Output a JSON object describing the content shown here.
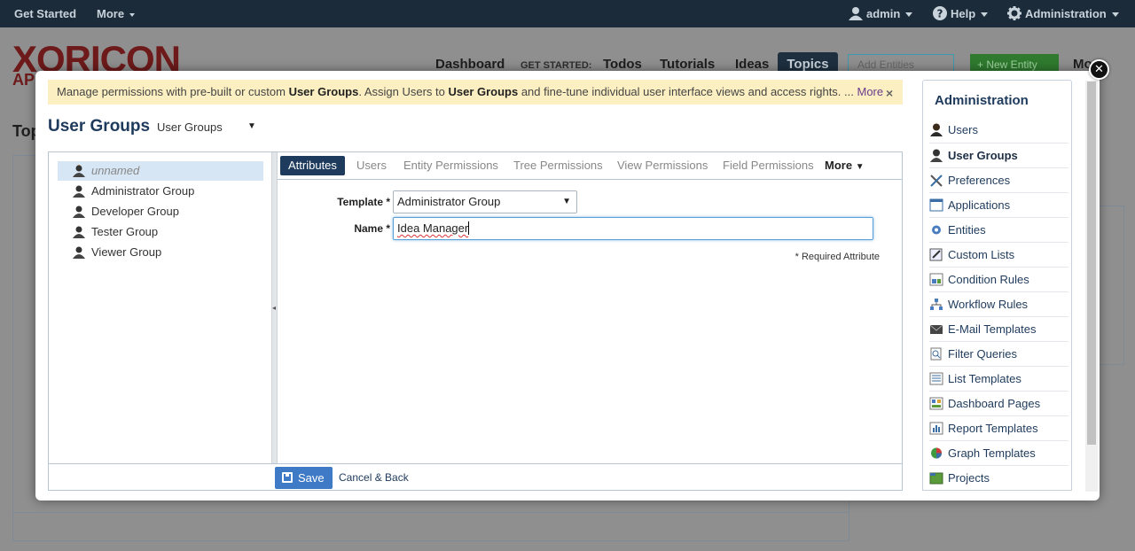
{
  "topbar": {
    "get_started": "Get Started",
    "more": "More",
    "user": "admin",
    "help": "Help",
    "administration": "Administration"
  },
  "background": {
    "logo": "XORICON",
    "logo_sub": "AP",
    "nav": {
      "dashboard": "Dashboard",
      "get_started_label": "GET STARTED:",
      "todos": "Todos",
      "tutorials": "Tutorials",
      "ideas": "Ideas",
      "topics": "Topics",
      "search_placeholder": "Add Entities",
      "new_entity": "New Entity",
      "more": "Mo"
    },
    "page_title": "Top"
  },
  "banner": {
    "text_1": "Manage permissions with pre-built or custom ",
    "bold_1": "User Groups",
    "text_2": ". Assign Users to ",
    "bold_2": "User Groups",
    "text_3": " and fine-tune individual user interface views and access rights. ... ",
    "more": "More",
    "close": "×"
  },
  "header": {
    "title": "User Groups",
    "selector_value": "User Groups"
  },
  "groups": [
    {
      "label": "unnamed"
    },
    {
      "label": "Administrator Group"
    },
    {
      "label": "Developer Group"
    },
    {
      "label": "Tester Group"
    },
    {
      "label": "Viewer Group"
    }
  ],
  "tabs": [
    {
      "label": "Attributes"
    },
    {
      "label": "Users"
    },
    {
      "label": "Entity Permissions"
    },
    {
      "label": "Tree Permissions"
    },
    {
      "label": "View Permissions"
    },
    {
      "label": "Field Permissions"
    },
    {
      "label": "More"
    }
  ],
  "form": {
    "template_label": "Template *",
    "template_value": "Administrator Group",
    "name_label": "Name *",
    "name_value": "Idea Manager",
    "required_note": "* Required Attribute"
  },
  "footer": {
    "save": "Save",
    "cancel": "Cancel & Back"
  },
  "admin": {
    "title": "Administration",
    "items": [
      {
        "label": "Users"
      },
      {
        "label": "User Groups"
      },
      {
        "label": "Preferences"
      },
      {
        "label": "Applications"
      },
      {
        "label": "Entities"
      },
      {
        "label": "Custom Lists"
      },
      {
        "label": "Condition Rules"
      },
      {
        "label": "Workflow Rules"
      },
      {
        "label": "E-Mail Templates"
      },
      {
        "label": "Filter Queries"
      },
      {
        "label": "List Templates"
      },
      {
        "label": "Dashboard Pages"
      },
      {
        "label": "Report Templates"
      },
      {
        "label": "Graph Templates"
      },
      {
        "label": "Projects"
      }
    ]
  },
  "colors": {
    "navy": "#1e3a5c",
    "banner_bg": "#fcf0c2",
    "save_blue": "#3f7ac6",
    "selected_row": "#d6e6f4"
  }
}
